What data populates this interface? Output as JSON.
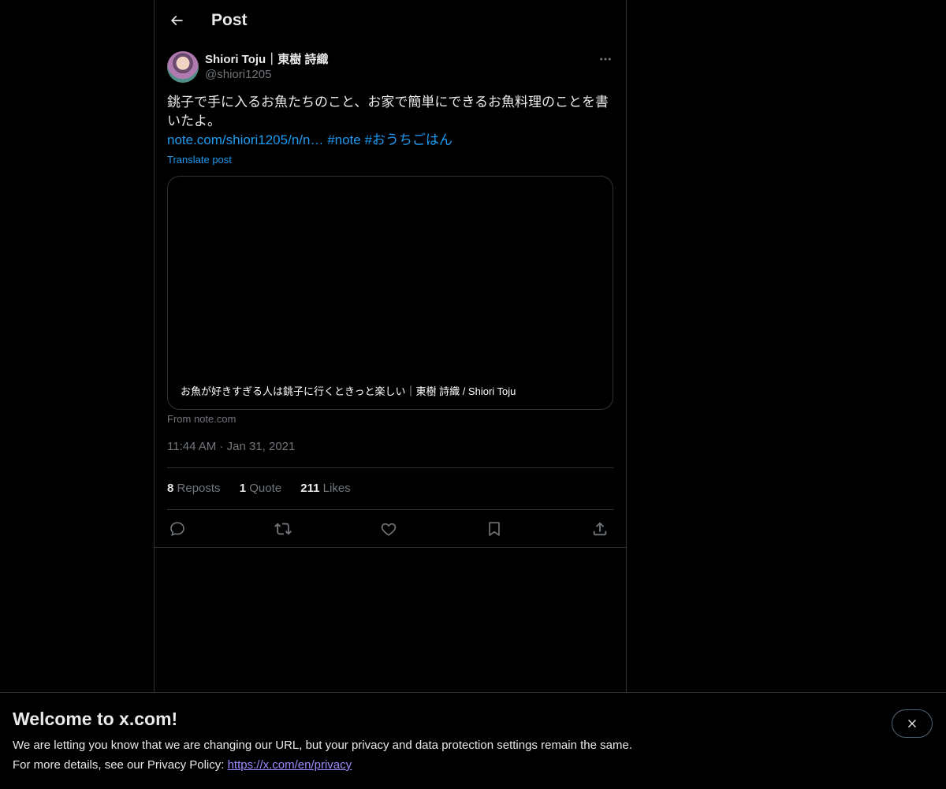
{
  "header": {
    "title": "Post",
    "back_icon": "arrow-left-icon"
  },
  "author": {
    "display_name": "Shiori Toju｜東樹 詩織",
    "handle": "@shiori1205",
    "avatar": "avatar-photo"
  },
  "post": {
    "text": "銚子で手に入るお魚たちのこと、お家で簡単にできるお魚料理のことを書いたよ。",
    "link_text": "note.com/shiori1205/n/n…",
    "hashtag1": "#note",
    "hashtag2": "#おうちごはん",
    "translate_label": "Translate post"
  },
  "card": {
    "title": "お魚が好きすぎる人は銚子に行くときっと楽しい｜東樹 詩織 / Shiori Toju",
    "source": "From note.com"
  },
  "timestamp": {
    "time": "11:44 AM",
    "separator": "·",
    "date": "Jan 31, 2021"
  },
  "stats": {
    "reposts_count": "8",
    "reposts_label": "Reposts",
    "quotes_count": "1",
    "quotes_label": "Quote",
    "likes_count": "211",
    "likes_label": "Likes"
  },
  "actions": [
    "reply-icon",
    "repost-icon",
    "like-icon",
    "bookmark-icon",
    "share-icon"
  ],
  "banner": {
    "title": "Welcome to x.com!",
    "line1": "We are letting you know that we are changing our URL, but your privacy and data protection settings remain the same.",
    "line2_prefix": "For more details, see our Privacy Policy: ",
    "line2_link": "https://x.com/en/privacy"
  },
  "colors": {
    "background": "#000000",
    "text": "#e7e9ea",
    "muted": "#71767b",
    "accent": "#1d9bf0",
    "border": "#2f3336",
    "privacy_link": "#9b8cff"
  }
}
